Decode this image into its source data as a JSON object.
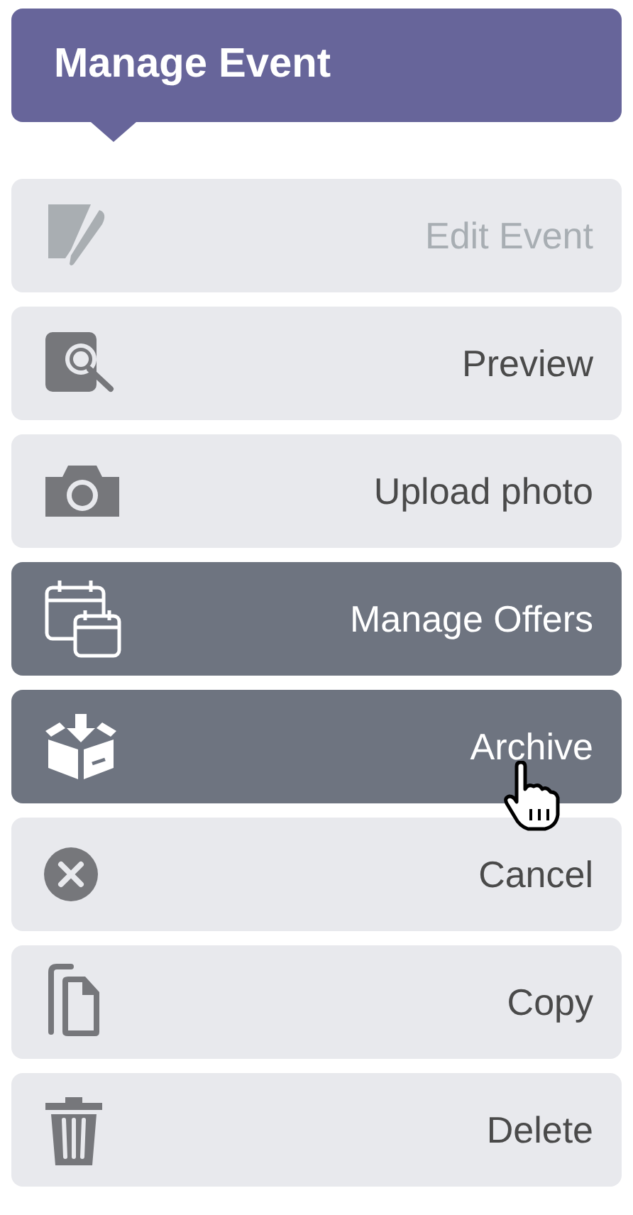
{
  "header": {
    "title": "Manage Event"
  },
  "items": [
    {
      "label": "Edit Event",
      "disabled": true,
      "highlighted": false,
      "pointer": false
    },
    {
      "label": "Preview",
      "disabled": false,
      "highlighted": false,
      "pointer": false
    },
    {
      "label": "Upload photo",
      "disabled": false,
      "highlighted": false,
      "pointer": false
    },
    {
      "label": "Manage Offers",
      "disabled": false,
      "highlighted": true,
      "pointer": false
    },
    {
      "label": "Archive",
      "disabled": false,
      "highlighted": true,
      "pointer": true
    },
    {
      "label": "Cancel",
      "disabled": false,
      "highlighted": false,
      "pointer": false
    },
    {
      "label": "Copy",
      "disabled": false,
      "highlighted": false,
      "pointer": false
    },
    {
      "label": "Delete",
      "disabled": false,
      "highlighted": false,
      "pointer": false
    }
  ]
}
